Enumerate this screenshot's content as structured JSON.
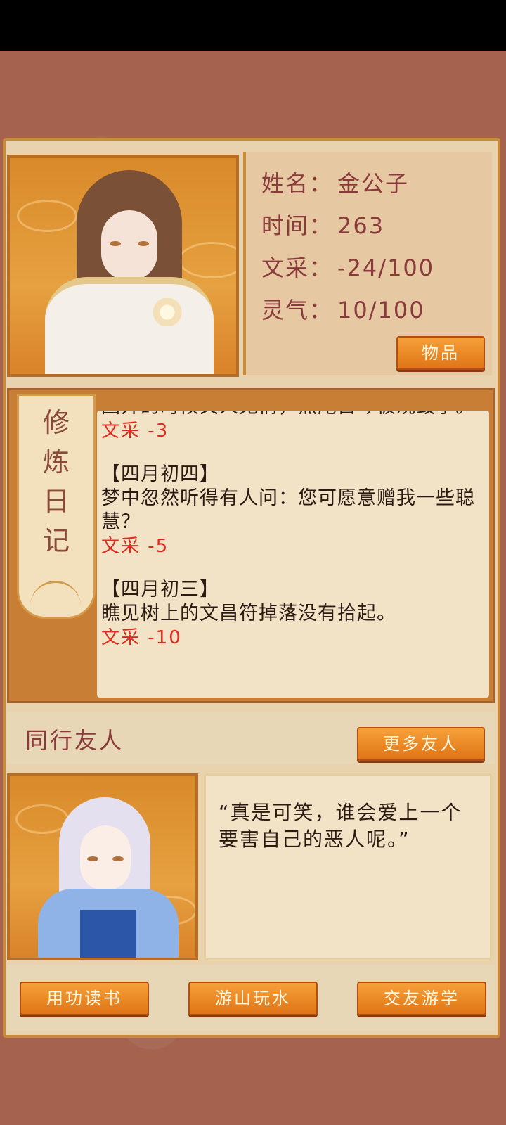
{
  "profile": {
    "name_label": "姓名：",
    "name_value": "金公子",
    "time_label": "时间：",
    "time_value": "263",
    "literary_label": "文采：",
    "literary_value": "-24/100",
    "spirit_label": "灵气：",
    "spirit_value": "10/100",
    "items_button": "物品"
  },
  "diary": {
    "tab_title": "修炼日记",
    "entries": [
      {
        "date": "",
        "text": "因开的时候文人无情，焦尾古琴被烧毁了。",
        "effect": "文采 -3"
      },
      {
        "date": "【四月初四】",
        "text": "梦中忽然听得有人问：您可愿意赠我一些聪慧？",
        "effect": "文采 -5"
      },
      {
        "date": "【四月初三】",
        "text": "瞧见树上的文昌符掉落没有拾起。",
        "effect": "文采 -10"
      }
    ]
  },
  "friends": {
    "title": "同行友人",
    "more_button": "更多友人",
    "quote": "“真是可笑，谁会爱上一个要害自己的恶人呢。”"
  },
  "actions": {
    "study": "用功读书",
    "travel": "游山玩水",
    "socialize": "交友游学"
  }
}
